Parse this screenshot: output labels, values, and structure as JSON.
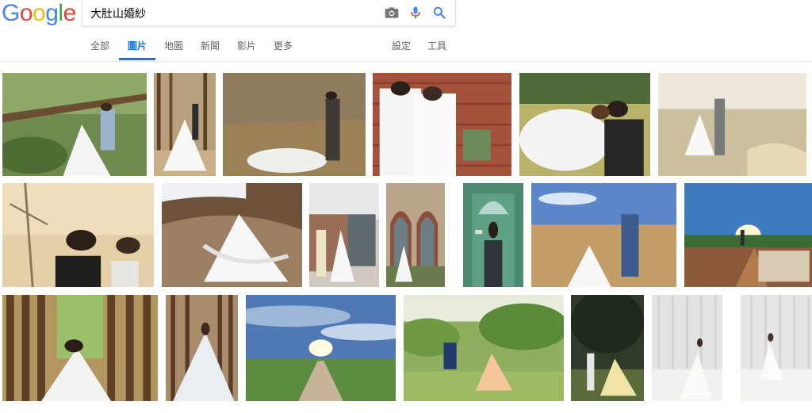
{
  "logo": {
    "letters": [
      "G",
      "o",
      "o",
      "g",
      "l",
      "e"
    ],
    "colors": [
      "#4285f4",
      "#ea4335",
      "#fbbc05",
      "#4285f4",
      "#34a853",
      "#ea4335"
    ]
  },
  "search": {
    "query": "大肚山婚紗"
  },
  "icons": {
    "camera": "camera-icon",
    "mic": "microphone-icon",
    "search": "search-icon"
  },
  "tabs": [
    {
      "label": "全部"
    },
    {
      "label": "圖片"
    },
    {
      "label": "地圖"
    },
    {
      "label": "新聞"
    },
    {
      "label": "影片"
    },
    {
      "label": "更多"
    }
  ],
  "tools": {
    "settings": "設定",
    "tools": "工具"
  },
  "accent": "#1a73e8"
}
